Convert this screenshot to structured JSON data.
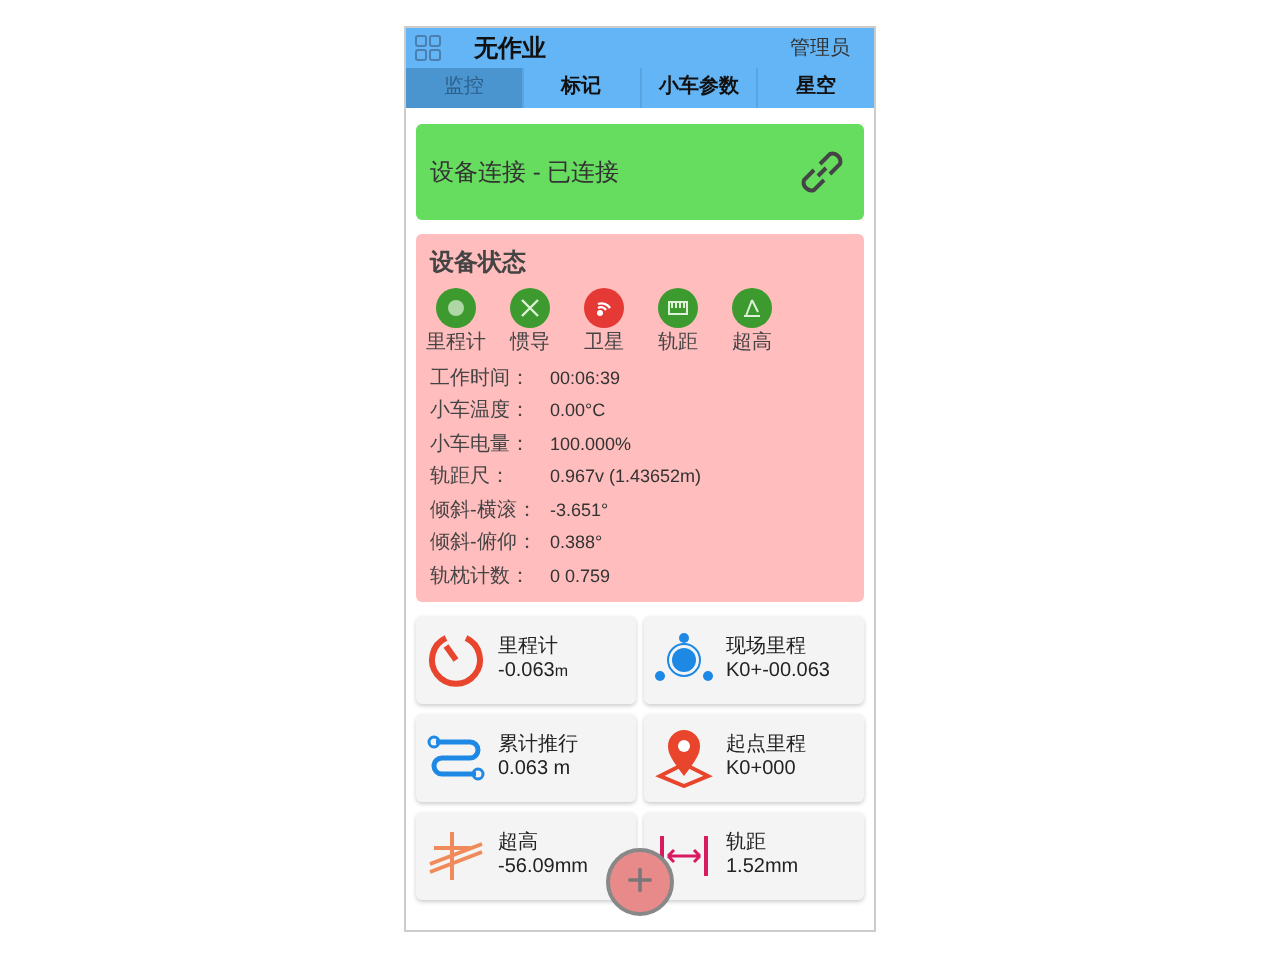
{
  "header": {
    "title": "无作业",
    "user": "管理员"
  },
  "tabs": [
    {
      "label": "监控",
      "selected": true
    },
    {
      "label": "标记",
      "selected": false
    },
    {
      "label": "小车参数",
      "selected": false
    },
    {
      "label": "星空",
      "selected": false
    }
  ],
  "connection": {
    "text": "设备连接 - 已连接",
    "connected": true
  },
  "device_status": {
    "title": "设备状态",
    "indicators": [
      {
        "kind": "odometer",
        "label": "里程计",
        "color": "#3c9a2e"
      },
      {
        "kind": "inertial",
        "label": "惯导",
        "color": "#3c9a2e"
      },
      {
        "kind": "satellite",
        "label": "卫星",
        "color": "#e53935"
      },
      {
        "kind": "track",
        "label": "轨距",
        "color": "#3c9a2e"
      },
      {
        "kind": "cant",
        "label": "超高",
        "color": "#3c9a2e"
      }
    ],
    "fields": [
      {
        "label": "工作时间：",
        "value": "00:06:39"
      },
      {
        "label": "小车温度：",
        "value": "0.00°C"
      },
      {
        "label": "小车电量：",
        "value": "100.000%"
      },
      {
        "label": "轨距尺：",
        "value": "0.967v (1.43652m)"
      },
      {
        "label": "倾斜-横滚：",
        "value": "-3.651°"
      },
      {
        "label": "倾斜-俯仰：",
        "value": "0.388°"
      },
      {
        "label": "轨枕计数：",
        "value": "0 0.759"
      }
    ]
  },
  "tiles": [
    {
      "kind": "gauge",
      "label": "里程计",
      "value": "-0.063",
      "unit": "m"
    },
    {
      "kind": "network",
      "label": "现场里程",
      "value": "K0+-00.063"
    },
    {
      "kind": "route",
      "label": "累计推行",
      "value": "0.063 m"
    },
    {
      "kind": "pin",
      "label": "起点里程",
      "value": "K0+000"
    },
    {
      "kind": "cant",
      "label": "超高",
      "value": "-56.09mm"
    },
    {
      "kind": "gauge-width",
      "label": "轨距",
      "value": "1.52mm"
    }
  ],
  "fab": {
    "symbol": "+"
  }
}
